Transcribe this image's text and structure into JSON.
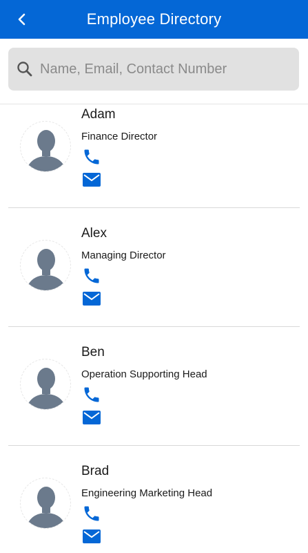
{
  "header": {
    "title": "Employee Directory",
    "back_icon": "chevron-left-icon",
    "color": "#0467d6"
  },
  "search": {
    "placeholder": "Name, Email, Contact Number",
    "value": "",
    "icon": "search-icon"
  },
  "employees": [
    {
      "name": "Adam",
      "role": "Finance Director"
    },
    {
      "name": "Alex",
      "role": "Managing Director"
    },
    {
      "name": "Ben",
      "role": "Operation Supporting Head"
    },
    {
      "name": "Brad",
      "role": "Engineering Marketing Head"
    }
  ],
  "icons": {
    "avatar": "user-silhouette-icon",
    "phone": "phone-icon",
    "email": "mail-icon",
    "accent": "#0467d6",
    "avatar_color": "#6b7a8c"
  }
}
